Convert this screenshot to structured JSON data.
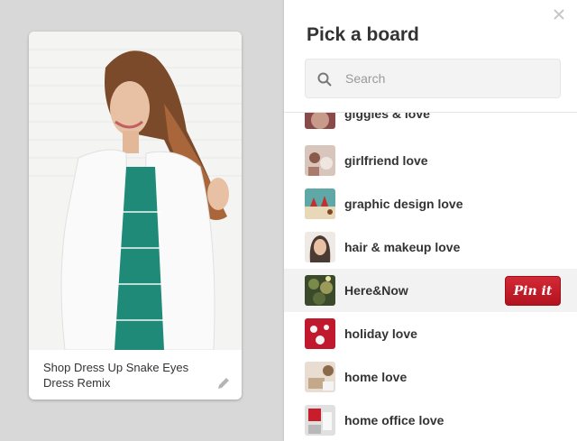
{
  "pin": {
    "caption": "Shop Dress Up Snake Eyes Dress Remix",
    "image_icon": "woman-white-blazer-photo"
  },
  "panel": {
    "title": "Pick a board",
    "search_placeholder": "Search",
    "close_icon": "close-icon"
  },
  "boards": [
    {
      "name": "giggles & love",
      "thumb_color": "#8a4a4a"
    },
    {
      "name": "girlfriend love",
      "thumb_color": "#d8c6bc"
    },
    {
      "name": "graphic design love",
      "thumb_color": "#5fa8a8"
    },
    {
      "name": "hair & makeup love",
      "thumb_color": "#4a3a34"
    },
    {
      "name": "Here&Now",
      "thumb_color": "#5a6a3a"
    },
    {
      "name": "holiday love",
      "thumb_color": "#c0182c"
    },
    {
      "name": "home love",
      "thumb_color": "#c4a88a"
    },
    {
      "name": "home office love",
      "thumb_color": "#e0e0e0"
    }
  ],
  "pinit_label": "Pin it",
  "accent_color": "#c8232c"
}
